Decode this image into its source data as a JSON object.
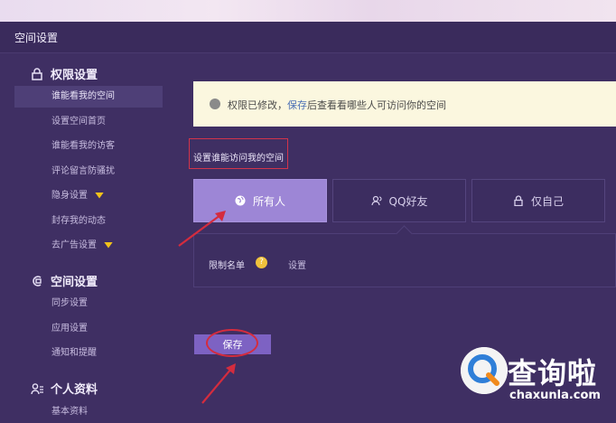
{
  "header": {
    "title": "空间设置"
  },
  "sidebar": {
    "sections": [
      {
        "title": "权限设置",
        "icon": "lock-icon",
        "items": [
          "谁能看我的空间",
          "设置空间首页",
          "谁能看我的访客",
          "评论留言防骚扰",
          "隐身设置",
          "封存我的动态",
          "去广告设置"
        ]
      },
      {
        "title": "空间设置",
        "icon": "space-settings-icon",
        "items": [
          "同步设置",
          "应用设置",
          "通知和提醒"
        ]
      },
      {
        "title": "个人资料",
        "icon": "profile-icon",
        "items": [
          "基本资料"
        ]
      }
    ],
    "active_item": "谁能看我的空间",
    "vip_badge_items": [
      "隐身设置",
      "去广告设置"
    ]
  },
  "notice": {
    "prefix": "权限已修改，",
    "link": "保存",
    "suffix": "后查看看哪些人可访问你的空间"
  },
  "prompt": "设置谁能访问我的空间",
  "options": [
    {
      "label": "所有人",
      "icon": "globe-icon",
      "selected": true
    },
    {
      "label": "QQ好友",
      "icon": "friends-icon",
      "selected": false
    },
    {
      "label": "仅自己",
      "icon": "lock-icon",
      "selected": false
    }
  ],
  "restriction": {
    "label": "限制名单",
    "help": "?",
    "action": "设置"
  },
  "save_button": "保存",
  "watermark": {
    "cn": "查询啦",
    "en": "chaxunla.com"
  },
  "colors": {
    "background": "#3f2f63",
    "accent": "#9d86d6",
    "button": "#7d62c3",
    "annotation": "#d42c3e"
  }
}
